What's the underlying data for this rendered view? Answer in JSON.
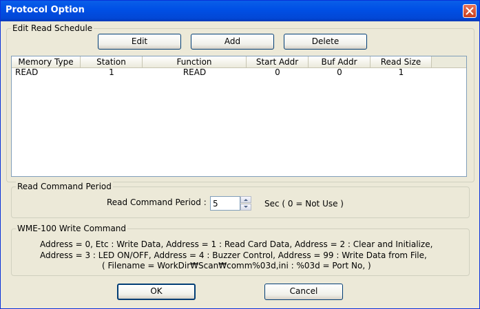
{
  "window": {
    "title": "Protocol Option"
  },
  "schedule": {
    "group_label": "Edit Read Schedule",
    "edit_label": "Edit",
    "add_label": "Add",
    "delete_label": "Delete",
    "columns": [
      "Memory Type",
      "Station",
      "Function",
      "Start Addr",
      "Buf Addr",
      "Read Size"
    ],
    "rows": [
      [
        "READ",
        "1",
        "READ",
        "0",
        "0",
        "1"
      ]
    ]
  },
  "period": {
    "group_label": "Read Command Period",
    "field_label": "Read Command Period :",
    "value": "5",
    "unit_note": "Sec ( 0 = Not Use )"
  },
  "wme": {
    "group_label": "WME-100 Write Command",
    "line1": "Address = 0, Etc : Write Data,    Address = 1 :  Read Card Data,    Address = 2 :  Clear and Initialize,",
    "line2": "Address = 3 : LED ON/OFF,      Address = 4 :  Buzzer Control,     Address = 99 :  Write Data from File,",
    "line3": "( Filename = WorkDir₩Scan₩comm%03d,ini  : %03d = Port No, )"
  },
  "footer": {
    "ok_label": "OK",
    "cancel_label": "Cancel"
  }
}
